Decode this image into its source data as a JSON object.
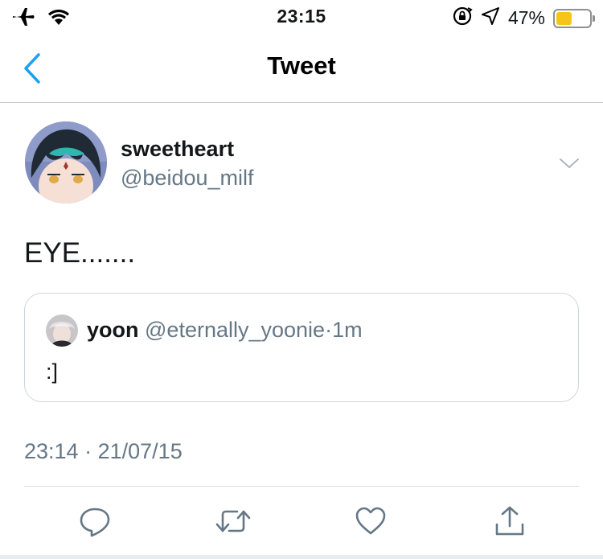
{
  "status_bar": {
    "time": "23:15",
    "battery_percent": "47%",
    "battery_level": 0.47,
    "battery_color": "#f5c518",
    "icons": [
      "airplane-icon",
      "wifi-icon",
      "orientation-lock-icon",
      "location-icon",
      "battery-icon"
    ]
  },
  "nav": {
    "title": "Tweet",
    "back_icon": "chevron-left-icon",
    "accent_color": "#1da1f2"
  },
  "tweet": {
    "display_name": "sweetheart",
    "handle": "@beidou_milf",
    "text": "EYE.......",
    "timestamp": "23:14",
    "timestamp_sep": "·",
    "date": "21/07/15",
    "menu_icon": "chevron-down-icon"
  },
  "quote": {
    "display_name": "yoon",
    "handle": "@eternally_yoonie",
    "separator": "·",
    "time": "1m",
    "text": ":]"
  },
  "actions": [
    {
      "name": "reply",
      "icon": "reply-icon"
    },
    {
      "name": "retweet",
      "icon": "retweet-icon"
    },
    {
      "name": "like",
      "icon": "heart-icon"
    },
    {
      "name": "share",
      "icon": "share-icon"
    }
  ],
  "colors": {
    "secondary_text": "#657786",
    "primary_text": "#14171a",
    "border": "#ccd6dd"
  }
}
